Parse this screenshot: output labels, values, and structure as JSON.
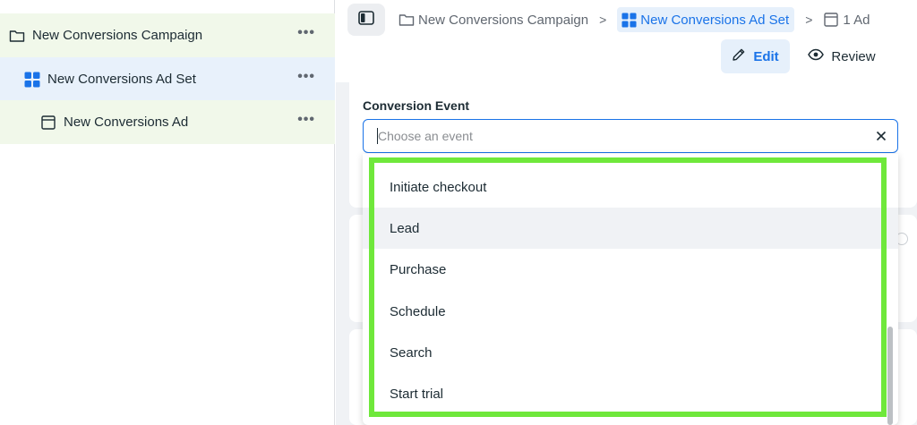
{
  "tree": {
    "campaign": {
      "label": "New Conversions Campaign",
      "icon": "folder-icon"
    },
    "adset": {
      "label": "New Conversions Ad Set",
      "icon": "grid-icon"
    },
    "ad": {
      "label": "New Conversions Ad",
      "icon": "ad-window-icon"
    },
    "more_glyph": "•••"
  },
  "breadcrumb": {
    "campaign": "New Conversions Campaign",
    "adset": "New Conversions Ad Set",
    "ad": "1 Ad",
    "separator": ">"
  },
  "actions": {
    "edit_label": "Edit",
    "review_label": "Review"
  },
  "conversion": {
    "label": "Conversion Event",
    "placeholder": "Choose an event",
    "options": [
      "Initiate checkout",
      "Lead",
      "Purchase",
      "Schedule",
      "Search",
      "Start trial"
    ],
    "hovered": "Lead"
  },
  "colors": {
    "accent": "#1a73e8",
    "highlight": "#6fe83b",
    "campaign_bg": "#f1f8ea",
    "adset_bg": "#e8f1fb"
  }
}
